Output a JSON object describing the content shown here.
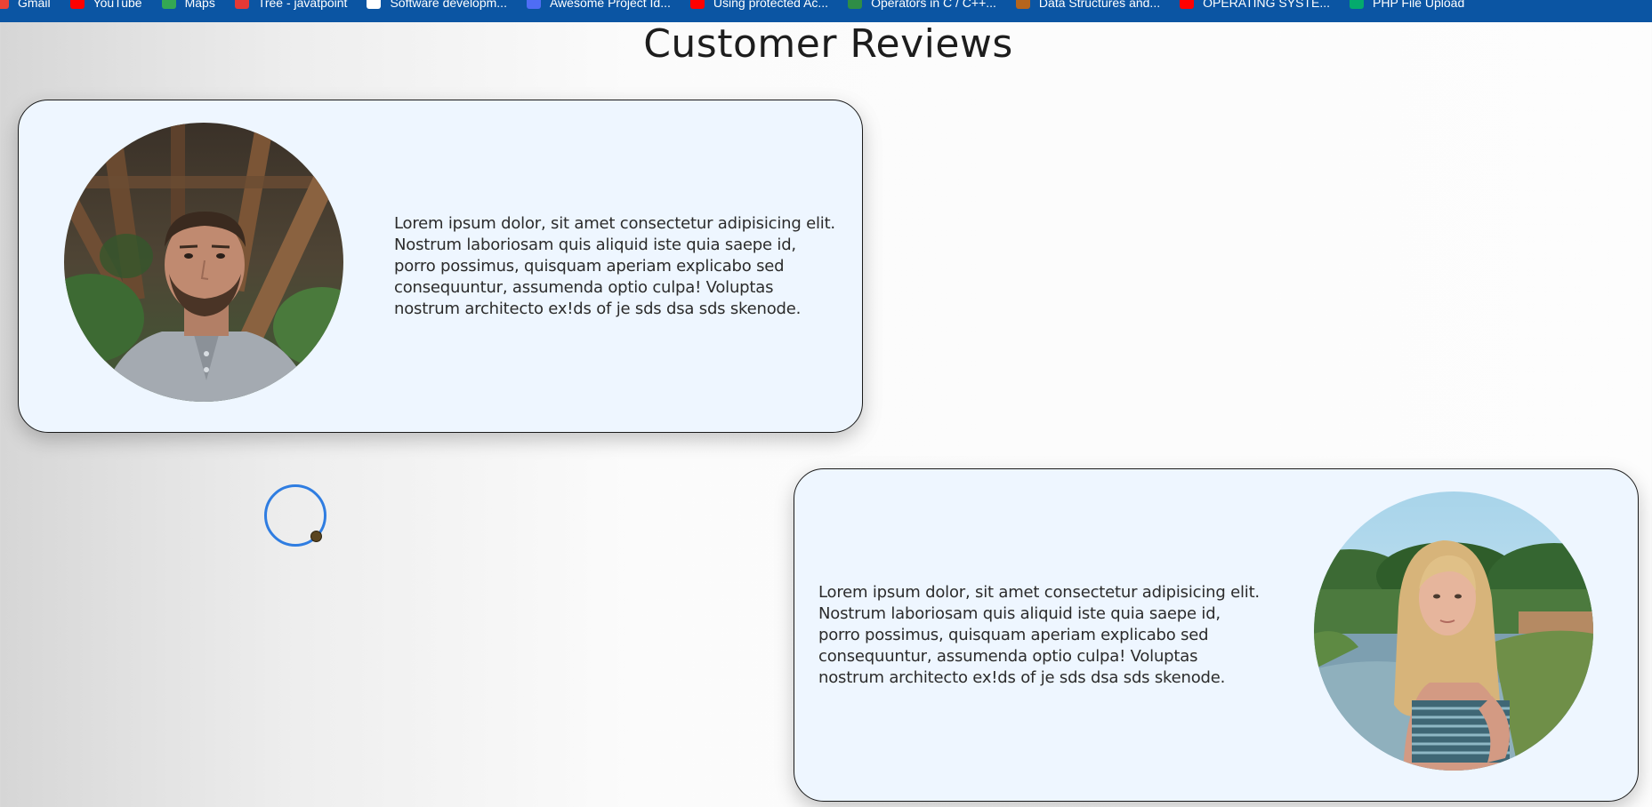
{
  "bookmarks": [
    {
      "label": "Gmail",
      "icon": "gmail-icon",
      "color": "#ea4335"
    },
    {
      "label": "YouTube",
      "icon": "youtube-icon",
      "color": "#ff0000"
    },
    {
      "label": "Maps",
      "icon": "maps-icon",
      "color": "#34a853"
    },
    {
      "label": "Tree - javatpoint",
      "icon": "javatpoint-icon",
      "color": "#e53935"
    },
    {
      "label": "Software developm...",
      "icon": "amazon-icon",
      "color": "#ffffff"
    },
    {
      "label": "Awesome Project Id...",
      "icon": "at-sign-icon",
      "color": "#4f6df5"
    },
    {
      "label": "Using protected Ac...",
      "icon": "youtube-icon",
      "color": "#ff0000"
    },
    {
      "label": "Operators in C / C++...",
      "icon": "geeksforgeeks-icon",
      "color": "#2f8d46"
    },
    {
      "label": "Data Structures and...",
      "icon": "cc-icon",
      "color": "#b5651d"
    },
    {
      "label": "OPERATING SYSTE...",
      "icon": "youtube-icon",
      "color": "#ff0000"
    },
    {
      "label": "PHP File Upload",
      "icon": "w3schools-icon",
      "color": "#04aa6d"
    }
  ],
  "page": {
    "title": "Customer Reviews"
  },
  "reviews": [
    {
      "text": "Lorem ipsum dolor, sit amet consectetur adipisicing elit. Nostrum laboriosam quis aliquid iste quia saepe id, porro possimus, quisquam aperiam explicabo sed consequuntur, assumenda optio culpa! Voluptas nostrum architecto ex!ds of je sds dsa sds skenode.",
      "avatar": "bearded man in grey henley shirt with wooden beams background"
    },
    {
      "text": "Lorem ipsum dolor, sit amet consectetur adipisicing elit. Nostrum laboriosam quis aliquid iste quia saepe id, porro possimus, quisquam aperiam explicabo sed consequuntur, assumenda optio culpa! Voluptas nostrum architecto ex!ds of je sds dsa sds skenode.",
      "avatar": "blonde woman in striped top near a river with trees"
    }
  ]
}
